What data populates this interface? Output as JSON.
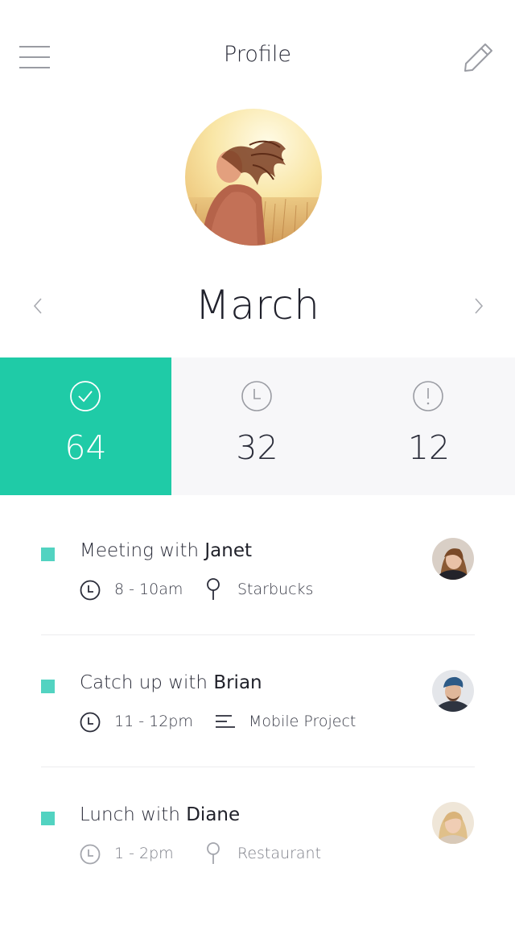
{
  "header": {
    "title": "Profile",
    "menu_icon": "hamburger-menu-icon",
    "edit_icon": "pencil-icon"
  },
  "month_selector": {
    "month": "March",
    "prev_icon": "chevron-left-icon",
    "next_icon": "chevron-right-icon"
  },
  "stats": [
    {
      "icon": "check-circle-icon",
      "value": "64",
      "active": true
    },
    {
      "icon": "clock-icon",
      "value": "32",
      "active": false
    },
    {
      "icon": "exclamation-circle-icon",
      "value": "12",
      "active": false
    }
  ],
  "events": [
    {
      "title_prefix": "Meeting with ",
      "person": "Janet",
      "time": "8 - 10am",
      "detail_icon": "map-pin-icon",
      "detail": "Starbucks"
    },
    {
      "title_prefix": "Catch up with ",
      "person": "Brian",
      "time": "11 - 12pm",
      "detail_icon": "text-lines-icon",
      "detail": "Mobile Project"
    },
    {
      "title_prefix": "Lunch with ",
      "person": "Diane",
      "time": "1 - 2pm",
      "detail_icon": "map-pin-icon",
      "detail": "Restaurant"
    }
  ],
  "colors": {
    "accent": "#1fcba7",
    "marker": "#52d3c1",
    "stats_background": "#f7f7f9",
    "text_dark": "#2b2d3a"
  }
}
